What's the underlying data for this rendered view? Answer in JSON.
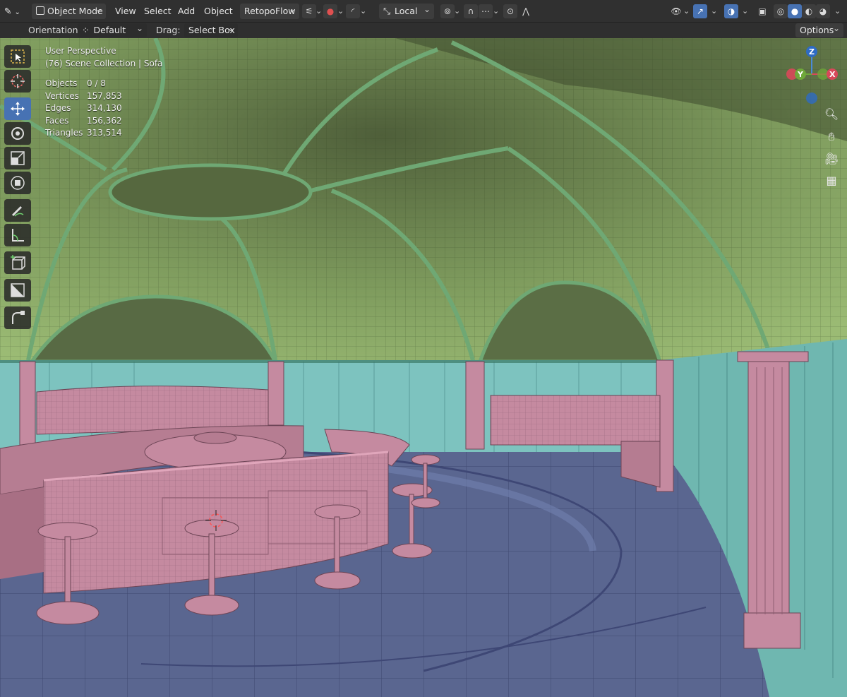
{
  "header": {
    "editor_type_icon": "pen-tool-icon",
    "mode": "Object Mode",
    "menus": [
      "View",
      "Select",
      "Add",
      "Object"
    ],
    "addon": "RetopoFlow",
    "transform_space": "Local",
    "options": "Options"
  },
  "subheader": {
    "orientation_label": "Orientation:",
    "orientation_value": "Default",
    "drag_label": "Drag:",
    "drag_value": "Select Box"
  },
  "overlay": {
    "view_name": "User Perspective",
    "collection": "(76) Scene Collection | Sofa",
    "stats": [
      {
        "label": "Objects",
        "value": "0 / 8"
      },
      {
        "label": "Vertices",
        "value": "157,853"
      },
      {
        "label": "Edges",
        "value": "314,130"
      },
      {
        "label": "Faces",
        "value": "156,362"
      },
      {
        "label": "Triangles",
        "value": "313,514"
      }
    ]
  },
  "gizmo": {
    "z": "Z",
    "y": "Y",
    "x": "X"
  },
  "toolbar": [
    "select-box-icon",
    "cursor-icon",
    "move-icon",
    "rotate-icon",
    "scale-icon",
    "transform-icon",
    "annotate-icon",
    "measure-icon",
    "add-cube-icon",
    "poly-build-icon",
    "curve-tool-icon"
  ],
  "colors": {
    "header": "#303030",
    "active": "#4772b3",
    "ceiling": "#8fae6a",
    "wall": "#7fc4c0",
    "floor": "#5a6690",
    "furniture": "#c58aa0"
  }
}
